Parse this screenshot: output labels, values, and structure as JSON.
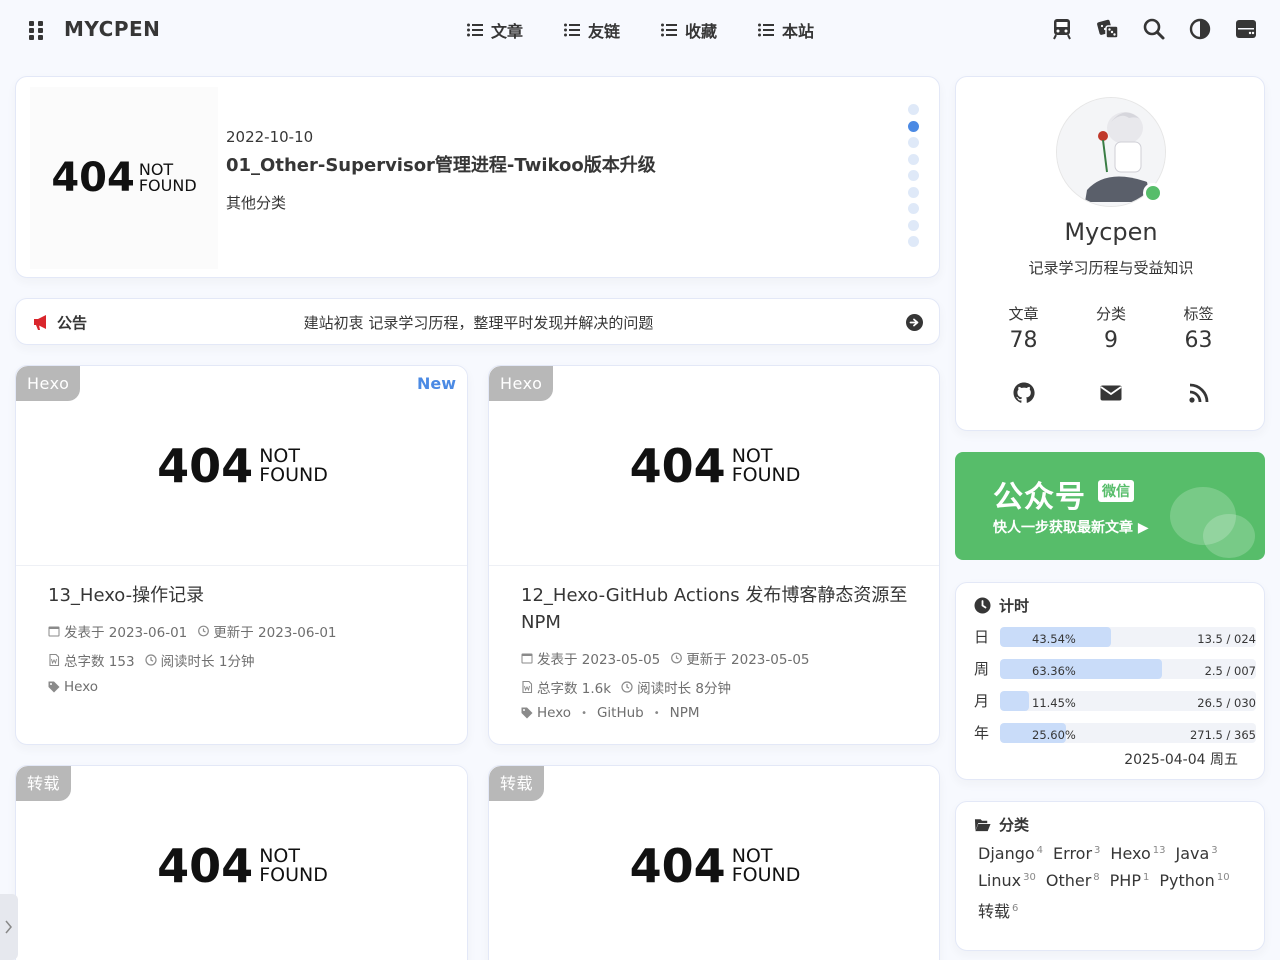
{
  "nav": {
    "brand": "MYCPEN",
    "links": [
      "文章",
      "友链",
      "收藏",
      "本站"
    ],
    "tools": [
      "train-icon",
      "dice-icon",
      "search-icon",
      "dark-mode-icon",
      "console-icon"
    ]
  },
  "hero": {
    "date": "2022-10-10",
    "title": "01_Other-Supervisor管理进程-Twikoo版本升级",
    "category": "其他分类",
    "active_dot": 2
  },
  "notice": {
    "label": "公告",
    "message": "建站初衷 记录学习历程，整理平时发现并解决的问题"
  },
  "posts": [
    {
      "tag": "Hexo",
      "badge": "New",
      "title": "13_Hexo-操作记录",
      "published": "发表于 2023-06-01",
      "updated": "更新于 2023-06-01",
      "words": "总字数 153",
      "reading": "阅读时长 1分钟",
      "tags": [
        "Hexo"
      ]
    },
    {
      "tag": "Hexo",
      "badge": "",
      "title": "12_Hexo-GitHub Actions 发布博客静态资源至 NPM",
      "published": "发表于 2023-05-05",
      "updated": "更新于 2023-05-05",
      "words": "总字数 1.6k",
      "reading": "阅读时长 8分钟",
      "tags": [
        "Hexo",
        "GitHub",
        "NPM"
      ]
    },
    {
      "tag": "转载"
    },
    {
      "tag": "转载"
    }
  ],
  "image_placeholder": {
    "big": "404",
    "line1": "NOT",
    "line2": "FOUND"
  },
  "profile": {
    "name": "Mycpen",
    "description": "记录学习历程与受益知识",
    "stats": [
      {
        "label": "文章",
        "value": "78"
      },
      {
        "label": "分类",
        "value": "9"
      },
      {
        "label": "标签",
        "value": "63"
      }
    ],
    "socials": [
      "github-icon",
      "envelope-icon",
      "rss-icon"
    ]
  },
  "wechat": {
    "title": "公众号",
    "badge": "微信",
    "subtitle": "快人一步获取最新文章 ▶"
  },
  "timer": {
    "title": "计时",
    "rows": [
      {
        "label": "日",
        "percent": "43.54%",
        "fraction": 0.4354,
        "count": "13.5 / 024"
      },
      {
        "label": "周",
        "percent": "63.36%",
        "fraction": 0.6336,
        "count": "2.5 / 007"
      },
      {
        "label": "月",
        "percent": "11.45%",
        "fraction": 0.1145,
        "count": "26.5 / 030"
      },
      {
        "label": "年",
        "percent": "25.60%",
        "fraction": 0.256,
        "count": "271.5 / 365"
      }
    ],
    "date": "2025-04-04 周五"
  },
  "categories": {
    "title": "分类",
    "items": [
      {
        "name": "Django",
        "count": "4"
      },
      {
        "name": "Error",
        "count": "3"
      },
      {
        "name": "Hexo",
        "count": "13"
      },
      {
        "name": "Java",
        "count": "3"
      },
      {
        "name": "Linux",
        "count": "30"
      },
      {
        "name": "Other",
        "count": "8"
      },
      {
        "name": "PHP",
        "count": "1"
      },
      {
        "name": "Python",
        "count": "10"
      },
      {
        "name": "转载",
        "count": "6"
      }
    ]
  },
  "colors": {
    "accent": "#4b8ae4",
    "wechat": "#57bd6a",
    "notice_icon": "#d9262c"
  }
}
